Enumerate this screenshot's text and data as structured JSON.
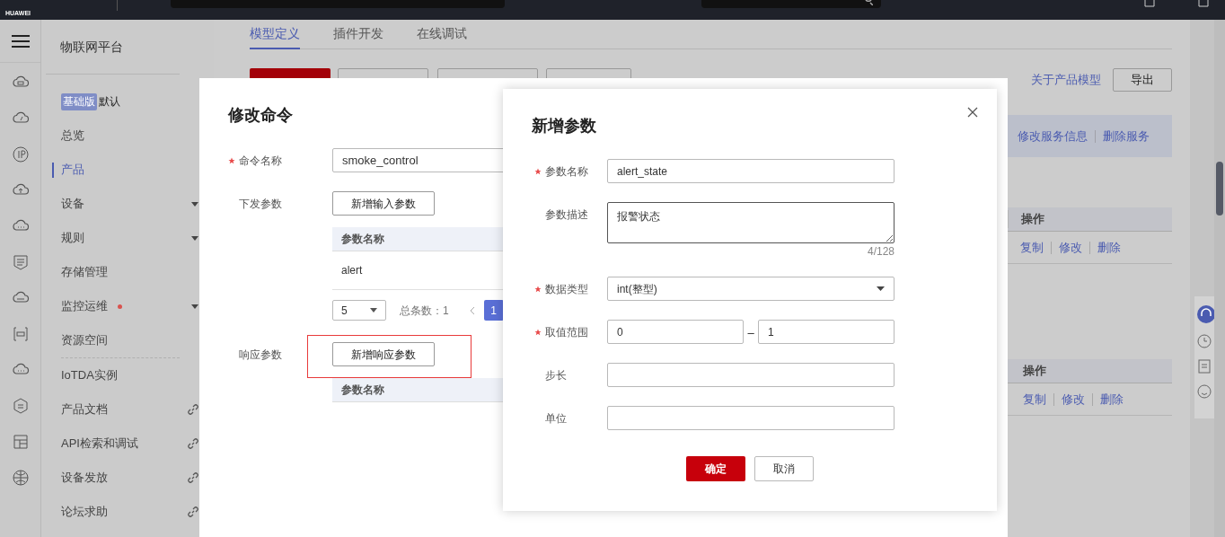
{
  "top_bar": {
    "logo_text": "HUAWEI"
  },
  "sidebar": {
    "title": "物联网平台",
    "edition_badge": "基础版",
    "edition_name": "默认",
    "items": [
      {
        "label": "总览",
        "expandable": false,
        "selected": false,
        "alert": false
      },
      {
        "label": "产品",
        "expandable": false,
        "selected": true,
        "alert": false
      },
      {
        "label": "设备",
        "expandable": true,
        "selected": false,
        "alert": false
      },
      {
        "label": "规则",
        "expandable": true,
        "selected": false,
        "alert": false
      },
      {
        "label": "存储管理",
        "expandable": false,
        "selected": false,
        "alert": false
      },
      {
        "label": "监控运维",
        "expandable": true,
        "selected": false,
        "alert": true
      },
      {
        "label": "资源空间",
        "expandable": false,
        "selected": false,
        "alert": false
      }
    ],
    "links": [
      {
        "label": "IoTDA实例",
        "external": false
      },
      {
        "label": "产品文档",
        "external": true
      },
      {
        "label": "API检索和调试",
        "external": true
      },
      {
        "label": "设备发放",
        "external": true
      },
      {
        "label": "论坛求助",
        "external": true
      }
    ]
  },
  "tabs": [
    {
      "label": "模型定义",
      "selected": true
    },
    {
      "label": "插件开发",
      "selected": false
    },
    {
      "label": "在线调试",
      "selected": false
    }
  ],
  "toolbar": {
    "link": "关于产品模型",
    "export_button": "导出"
  },
  "service_bar": {
    "actions": [
      "修改服务信息",
      "删除服务"
    ]
  },
  "tables": [
    {
      "action_header": "操作",
      "row_actions": [
        "复制",
        "修改",
        "删除"
      ]
    },
    {
      "action_header": "操作",
      "row_actions": [
        "复制",
        "修改",
        "删除"
      ]
    }
  ],
  "command_dialog": {
    "title": "修改命令",
    "name_field": {
      "label": "命令名称",
      "required": true,
      "value": "smoke_control"
    },
    "downlink": {
      "label": "下发参数",
      "button": "新增输入参数",
      "highlighted": false,
      "column": "参数名称",
      "rows": [
        "alert"
      ]
    },
    "pagination": {
      "page_size": "5",
      "total": "总条数：1",
      "pages": [
        {
          "label": "1",
          "selected": true
        }
      ]
    },
    "response": {
      "label": "响应参数",
      "button": "新增响应参数",
      "highlighted": true,
      "column": "参数名称"
    }
  },
  "param_dialog": {
    "title": "新增参数",
    "fields": [
      {
        "kind": "input",
        "label": "参数名称",
        "required": true,
        "value": "alert_state"
      },
      {
        "kind": "textarea",
        "label": "参数描述",
        "required": false,
        "value": "报警状态",
        "counter": "4/128"
      },
      {
        "kind": "select",
        "label": "数据类型",
        "required": true,
        "value": "int(整型)"
      },
      {
        "kind": "range",
        "label": "取值范围",
        "required": true,
        "values": [
          "0",
          "1"
        ],
        "separator": "–"
      },
      {
        "kind": "input",
        "label": "步长",
        "required": false
      },
      {
        "kind": "input",
        "label": "单位",
        "required": false
      }
    ],
    "confirm": "确定",
    "cancel": "取消"
  }
}
